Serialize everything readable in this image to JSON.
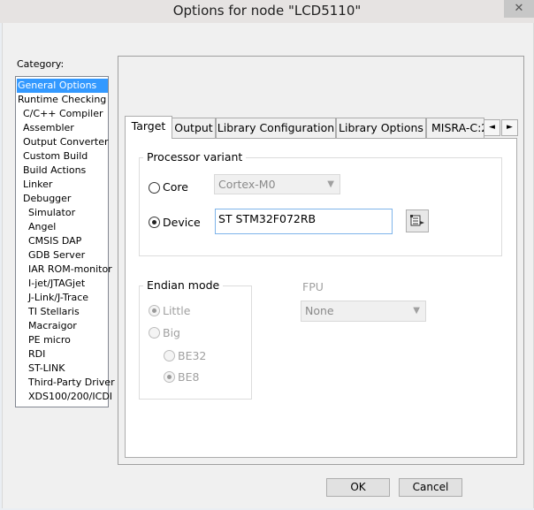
{
  "window": {
    "title": "Options for node \"LCD5110\"",
    "close_glyph": "✕"
  },
  "category": {
    "label": "Category:",
    "items": [
      {
        "label": "General Options",
        "selected": true
      },
      {
        "label": "Runtime Checking"
      },
      {
        "label": "C/C++ Compiler"
      },
      {
        "label": "Assembler"
      },
      {
        "label": "Output Converter"
      },
      {
        "label": "Custom Build"
      },
      {
        "label": "Build Actions"
      },
      {
        "label": "Linker"
      },
      {
        "label": "Debugger"
      },
      {
        "label": "Simulator"
      },
      {
        "label": "Angel"
      },
      {
        "label": "CMSIS DAP"
      },
      {
        "label": "GDB Server"
      },
      {
        "label": "IAR ROM-monitor"
      },
      {
        "label": "I-jet/JTAGjet"
      },
      {
        "label": "J-Link/J-Trace"
      },
      {
        "label": "TI Stellaris"
      },
      {
        "label": "Macraigor"
      },
      {
        "label": "PE micro"
      },
      {
        "label": "RDI"
      },
      {
        "label": "ST-LINK"
      },
      {
        "label": "Third-Party Driver"
      },
      {
        "label": "XDS100/200/ICDI"
      }
    ]
  },
  "tabs": [
    "Target",
    "Output",
    "Library Configuration",
    "Library Options",
    "MISRA-C:2"
  ],
  "active_tab": "Target",
  "tab_scroll": {
    "left": "◄",
    "right": "►"
  },
  "processor_variant": {
    "title": "Processor variant",
    "core_label": "Core",
    "core_value": "Cortex-M0",
    "device_label": "Device",
    "device_value": "ST STM32F072RB",
    "selected": "Device"
  },
  "endian_mode": {
    "title": "Endian mode",
    "little_label": "Little",
    "big_label": "Big",
    "be32_label": "BE32",
    "be8_label": "BE8",
    "selected": "Little",
    "sub_selected": "BE8"
  },
  "fpu": {
    "label": "FPU",
    "value": "None"
  },
  "buttons": {
    "ok": "OK",
    "cancel": "Cancel"
  },
  "colors": {
    "selection": "#3399ff",
    "focus_border": "#7eb4ea"
  }
}
